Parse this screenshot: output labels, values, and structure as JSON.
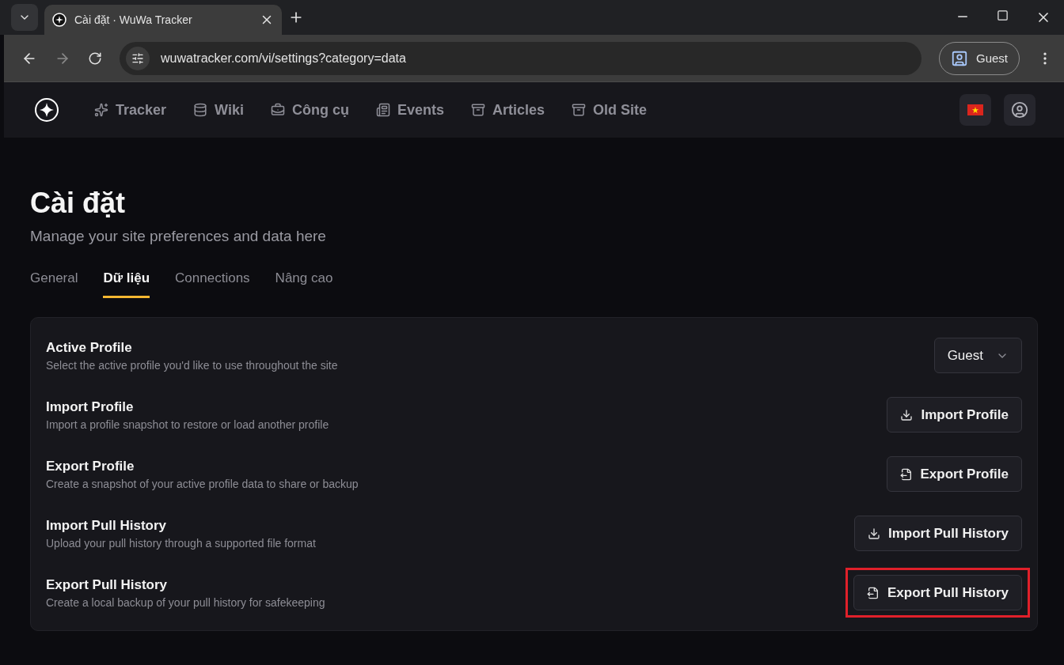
{
  "browser": {
    "tab_title": "Cài đặt · WuWa Tracker",
    "url": "wuwatracker.com/vi/settings?category=data",
    "profile": "Guest"
  },
  "nav": {
    "items": [
      {
        "label": "Tracker"
      },
      {
        "label": "Wiki"
      },
      {
        "label": "Công cụ"
      },
      {
        "label": "Events"
      },
      {
        "label": "Articles"
      },
      {
        "label": "Old Site"
      }
    ]
  },
  "page": {
    "title": "Cài đặt",
    "subtitle": "Manage your site preferences and data here"
  },
  "tabs": [
    {
      "label": "General",
      "selected": false
    },
    {
      "label": "Dữ liệu",
      "selected": true
    },
    {
      "label": "Connections",
      "selected": false
    },
    {
      "label": "Nâng cao",
      "selected": false
    }
  ],
  "settings": [
    {
      "title": "Active Profile",
      "description": "Select the active profile you'd like to use throughout the site",
      "kind": "select",
      "control": "Guest",
      "highlighted": false
    },
    {
      "title": "Import Profile",
      "description": "Import a profile snapshot to restore or load another profile",
      "kind": "import",
      "control": "Import Profile",
      "highlighted": false
    },
    {
      "title": "Export Profile",
      "description": "Create a snapshot of your active profile data to share or backup",
      "kind": "export",
      "control": "Export Profile",
      "highlighted": false
    },
    {
      "title": "Import Pull History",
      "description": "Upload your pull history through a supported file format",
      "kind": "import",
      "control": "Import Pull History",
      "highlighted": false
    },
    {
      "title": "Export Pull History",
      "description": "Create a local backup of your pull history for safekeeping",
      "kind": "export",
      "control": "Export Pull History",
      "highlighted": true
    }
  ]
}
